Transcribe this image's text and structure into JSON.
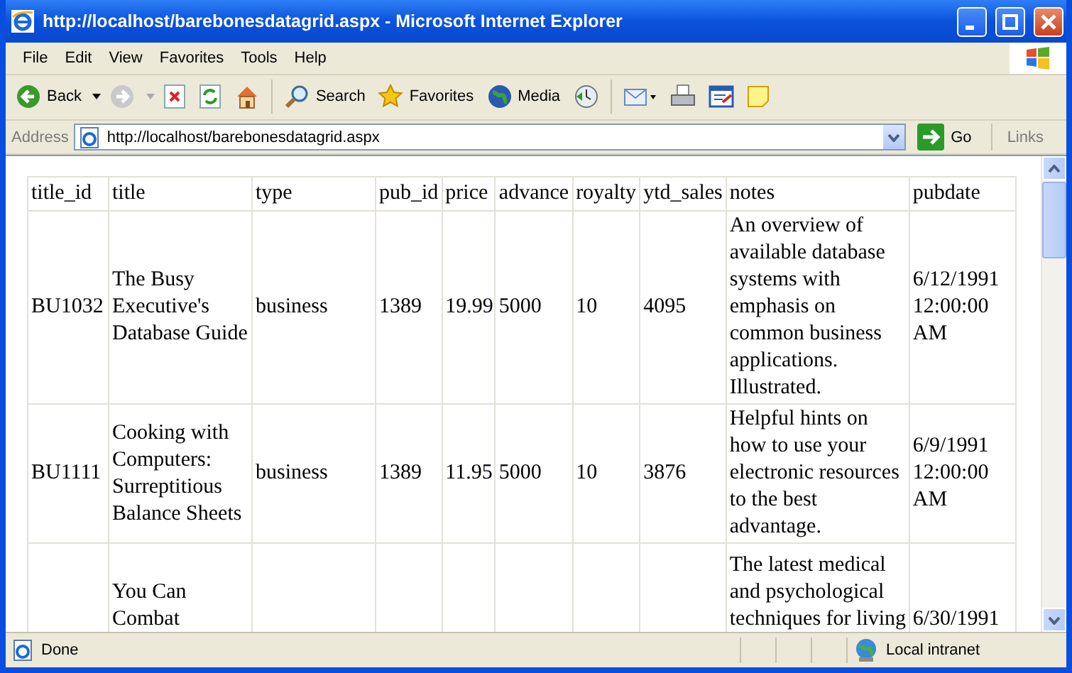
{
  "window": {
    "title": "http://localhost/barebonesdatagrid.aspx - Microsoft Internet Explorer"
  },
  "menu": [
    {
      "label": "File"
    },
    {
      "label": "Edit"
    },
    {
      "label": "View"
    },
    {
      "label": "Favorites"
    },
    {
      "label": "Tools"
    },
    {
      "label": "Help"
    }
  ],
  "toolbar": [
    {
      "kind": "back",
      "label": "Back"
    },
    {
      "kind": "forward"
    },
    {
      "kind": "stop"
    },
    {
      "kind": "refresh"
    },
    {
      "kind": "home"
    },
    {
      "kind": "search",
      "label": "Search"
    },
    {
      "kind": "favorites",
      "label": "Favorites"
    },
    {
      "kind": "media",
      "label": "Media"
    },
    {
      "kind": "history"
    },
    {
      "kind": "mail"
    },
    {
      "kind": "print"
    },
    {
      "kind": "edit"
    },
    {
      "kind": "note"
    }
  ],
  "address": {
    "label": "Address",
    "value": "http://localhost/barebonesdatagrid.aspx",
    "go": "Go",
    "links": "Links"
  },
  "table": {
    "columns": [
      "title_id",
      "title",
      "type",
      "pub_id",
      "price",
      "advance",
      "royalty",
      "ytd_sales",
      "notes",
      "pubdate"
    ],
    "rows": [
      {
        "partial": false,
        "cells": [
          "BU1032",
          "The Busy Executive's Database Guide",
          "business",
          "1389",
          "19.99",
          "5000",
          "10",
          "4095",
          "An overview of available database systems with emphasis on common business applications. Illustrated.",
          "6/12/1991 12:00:00 AM"
        ]
      },
      {
        "partial": false,
        "cells": [
          "BU1111",
          "Cooking with Computers: Surreptitious Balance Sheets",
          "business",
          "1389",
          "11.95",
          "5000",
          "10",
          "3876",
          "Helpful hints on how to use your electronic resources to the best advantage.",
          "6/9/1991 12:00:00 AM"
        ]
      },
      {
        "partial": true,
        "cells": [
          null,
          "You Can Combat",
          null,
          null,
          null,
          null,
          null,
          null,
          "The latest medical and psychological techniques for living",
          "6/30/1991"
        ]
      }
    ]
  },
  "status_bar": {
    "text": "Done",
    "zone": "Local intranet"
  }
}
